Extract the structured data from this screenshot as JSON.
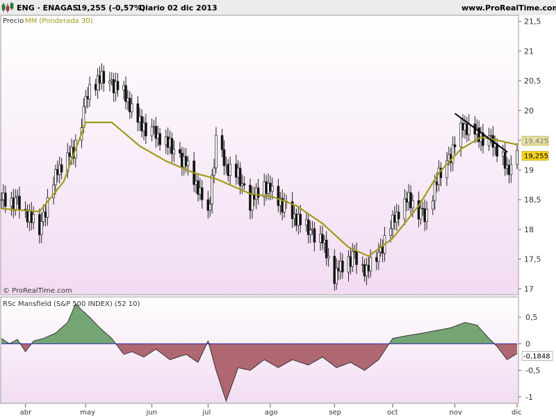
{
  "header": {
    "symbol": "ENG · ENAGAS",
    "quote": "19,255 (-0,57%)",
    "period": "Diario  02 dic 2013",
    "site": "www.ProRealTime.com"
  },
  "price_panel": {
    "label_price": "Precio",
    "label_ma": "MM (Ponderada 30)",
    "copyright": "© ProRealTime.com",
    "ma_value": "19,425",
    "last_value": "19,255"
  },
  "rsc_panel": {
    "label": "RSc Mansfield (S&P 500 INDEX) (52 10)",
    "last_value": "-0,1848"
  },
  "colors": {
    "background_top": "#ffffff",
    "background_bottom": "#f2dcf2",
    "candle_up": "#ffffff",
    "candle_down": "#111111",
    "ma_line": "#a09a18",
    "ma_tag": "#e8e2a8",
    "last_tag": "#f5d21f",
    "rsc_positive": "#5d965d",
    "rsc_negative": "#a2505a",
    "zero_line": "#2a2aa0",
    "trendline": "#000000"
  },
  "chart_data": [
    {
      "type": "candlestick",
      "title": "ENG · ENAGAS",
      "frequency": "daily",
      "y_tick_labels": [
        "21,5",
        "21",
        "20,5",
        "20",
        "19,5",
        "19",
        "18,5",
        "18",
        "17,5",
        "17"
      ],
      "y_ticks": [
        21.5,
        21,
        20.5,
        20,
        19.5,
        19,
        18.5,
        18,
        17.5,
        17
      ],
      "ylim": [
        16.9,
        21.6
      ],
      "x_tick_labels": [
        "abr",
        "may",
        "jun",
        "jul",
        "ago",
        "sep",
        "oct",
        "nov",
        "dic"
      ],
      "x_tick_dates": [
        "2013-04-01",
        "2013-05-01",
        "2013-06-03",
        "2013-07-01",
        "2013-08-01",
        "2013-09-02",
        "2013-10-01",
        "2013-11-01",
        "2013-12-02"
      ],
      "x_range": [
        "2013-03-20",
        "2013-12-02"
      ],
      "close_anchors": {
        "dates": [
          "2013-03-20",
          "2013-03-28",
          "2013-04-08",
          "2013-04-17",
          "2013-04-25",
          "2013-05-03",
          "2013-05-10",
          "2013-05-20",
          "2013-05-27",
          "2013-06-05",
          "2013-06-12",
          "2013-06-20",
          "2013-06-26",
          "2013-07-01",
          "2013-07-05",
          "2013-07-10",
          "2013-07-16",
          "2013-07-22",
          "2013-07-29",
          "2013-08-05",
          "2013-08-12",
          "2013-08-20",
          "2013-08-27",
          "2013-09-02",
          "2013-09-05",
          "2013-09-11",
          "2013-09-18",
          "2013-09-25",
          "2013-10-02",
          "2013-10-09",
          "2013-10-17",
          "2013-10-24",
          "2013-10-30",
          "2013-11-05",
          "2013-11-11",
          "2013-11-15",
          "2013-11-20",
          "2013-11-25",
          "2013-11-27",
          "2013-12-02"
        ],
        "values": [
          18.5,
          18.45,
          18.0,
          19.0,
          19.3,
          20.4,
          20.55,
          20.3,
          19.8,
          19.6,
          19.4,
          19.1,
          18.7,
          18.2,
          19.5,
          19.05,
          18.9,
          18.45,
          18.75,
          18.5,
          18.25,
          18.0,
          17.8,
          17.2,
          17.35,
          17.55,
          17.3,
          17.65,
          18.2,
          18.5,
          18.2,
          18.9,
          19.25,
          19.75,
          19.6,
          19.55,
          19.45,
          19.2,
          18.95,
          19.255
        ]
      },
      "candle_variation": [
        0,
        0.12,
        -0.1,
        0.06,
        -0.14,
        0.08,
        0.11,
        -0.07,
        0.04,
        -0.12,
        0.1,
        -0.05,
        0.13,
        -0.09,
        0.02,
        0.07,
        -0.13,
        0.09,
        -0.03,
        0.12,
        -0.08,
        0.05,
        -0.11,
        0.1
      ],
      "series": [
        {
          "name": "MM (Ponderada 30)",
          "last": 19.425,
          "dates": [
            "2013-03-20",
            "2013-04-08",
            "2013-04-20",
            "2013-05-01",
            "2013-05-14",
            "2013-05-28",
            "2013-06-10",
            "2013-06-24",
            "2013-07-05",
            "2013-07-22",
            "2013-08-02",
            "2013-08-14",
            "2013-08-27",
            "2013-09-09",
            "2013-09-19",
            "2013-10-01",
            "2013-10-14",
            "2013-10-24",
            "2013-11-04",
            "2013-11-14",
            "2013-11-22",
            "2013-12-02"
          ],
          "values": [
            18.35,
            18.3,
            18.8,
            19.8,
            19.8,
            19.4,
            19.15,
            18.95,
            18.85,
            18.6,
            18.55,
            18.4,
            18.1,
            17.7,
            17.55,
            17.85,
            18.4,
            18.95,
            19.35,
            19.55,
            19.5,
            19.425
          ]
        }
      ],
      "trendline": {
        "dates": [
          "2013-11-01",
          "2013-12-02"
        ],
        "values": [
          19.95,
          19.3
        ]
      }
    },
    {
      "type": "area",
      "title": "RSc Mansfield (S&P 500 INDEX) (52 10)",
      "y_tick_labels": [
        "0,5",
        "0",
        "-0,5",
        "-1"
      ],
      "y_ticks": [
        0.5,
        0,
        -0.5,
        -1
      ],
      "ylim": [
        -1.12,
        0.88
      ],
      "last": -0.1848,
      "series": [
        {
          "name": "RSc Mansfield",
          "dates": [
            "2013-03-20",
            "2013-03-24",
            "2013-03-28",
            "2013-04-01",
            "2013-04-05",
            "2013-04-10",
            "2013-04-16",
            "2013-04-22",
            "2013-04-26",
            "2013-04-30",
            "2013-05-03",
            "2013-05-08",
            "2013-05-14",
            "2013-05-20",
            "2013-05-24",
            "2013-05-30",
            "2013-06-05",
            "2013-06-12",
            "2013-06-20",
            "2013-06-26",
            "2013-07-01",
            "2013-07-05",
            "2013-07-10",
            "2013-07-16",
            "2013-07-22",
            "2013-07-29",
            "2013-08-05",
            "2013-08-12",
            "2013-08-20",
            "2013-08-27",
            "2013-09-03",
            "2013-09-10",
            "2013-09-17",
            "2013-09-24",
            "2013-10-01",
            "2013-10-08",
            "2013-10-16",
            "2013-10-23",
            "2013-10-30",
            "2013-11-06",
            "2013-11-12",
            "2013-11-18",
            "2013-11-22",
            "2013-11-27",
            "2013-12-02"
          ],
          "values": [
            0.1,
            0.0,
            0.08,
            -0.15,
            0.05,
            0.1,
            0.2,
            0.4,
            0.75,
            0.6,
            0.5,
            0.3,
            0.1,
            -0.2,
            -0.15,
            -0.25,
            -0.1,
            -0.3,
            -0.2,
            -0.35,
            0.05,
            -0.5,
            -1.08,
            -0.45,
            -0.5,
            -0.3,
            -0.45,
            -0.3,
            -0.4,
            -0.25,
            -0.45,
            -0.35,
            -0.5,
            -0.3,
            0.1,
            0.15,
            0.2,
            0.25,
            0.3,
            0.4,
            0.35,
            0.1,
            -0.05,
            -0.3,
            -0.185
          ]
        }
      ]
    }
  ]
}
